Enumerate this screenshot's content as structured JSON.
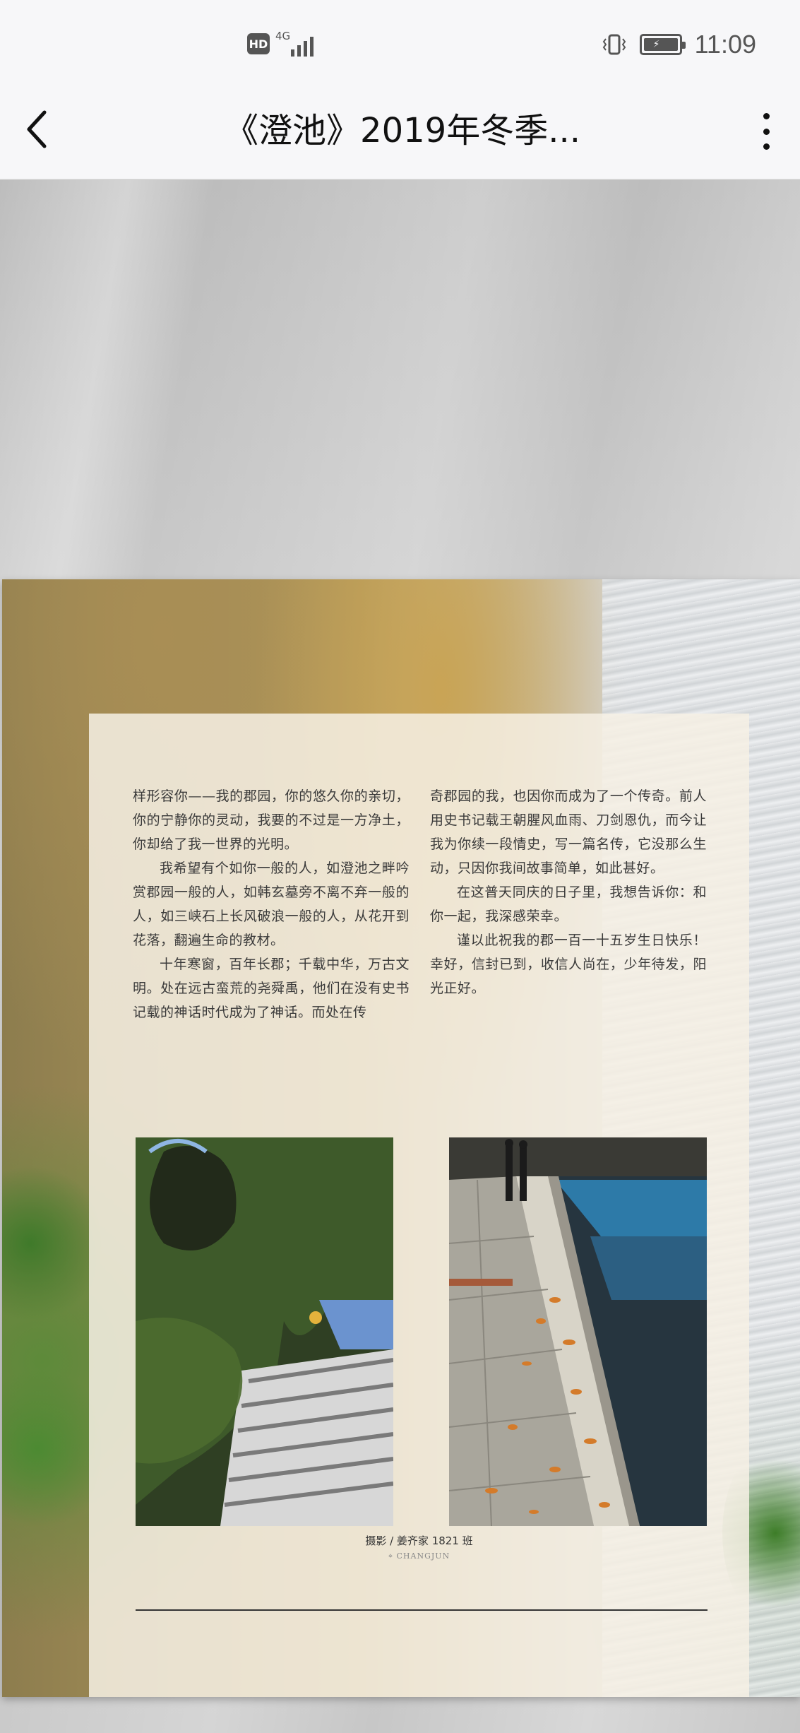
{
  "status_bar": {
    "hd": "HD",
    "network": "4G",
    "time": "11:09"
  },
  "header": {
    "title": "《澄池》2019年冬季..."
  },
  "icons": {
    "back": "back-arrow-icon",
    "more": "more-vertical-icon",
    "signal": "signal-icon",
    "vibrate": "vibrate-icon",
    "battery": "battery-charging-icon",
    "location": "location-pin-icon"
  },
  "article": {
    "left_column": [
      "样形容你——我的郡园，你的悠久你的亲切，你的宁静你的灵动，我要的不过是一方净土，你却给了我一世界的光明。",
      "我希望有个如你一般的人，如澄池之畔吟赏郡园一般的人，如韩玄墓旁不离不弃一般的人，如三峡石上长风破浪一般的人，从花开到花落，翻遍生命的教材。",
      "十年寒窗，百年长郡；千载中华，万古文明。处在远古蛮荒的尧舜禹，他们在没有史书记载的神话时代成为了神话。而处在传"
    ],
    "right_column": [
      "奇郡园的我，也因你而成为了一个传奇。前人用史书记载王朝腥风血雨、刀剑恩仇，而今让我为你续一段情史，写一篇名传，它没那么生动，只因你我间故事简单，如此甚好。",
      "在这普天同庆的日子里，我想告诉你：和你一起，我深感荣幸。",
      "谨以此祝我的郡一百一十五岁生日快乐！幸好，信封已到，收信人尚在，少年待发，阳光正好。"
    ]
  },
  "photos": {
    "left": "tree-building-photo",
    "right": "sidewalk-autumn-leaves-photo"
  },
  "caption": {
    "credit": "摄影 / 姜齐家 1821 班",
    "location": "CHANGJUN"
  },
  "colors": {
    "toolbar_bg": "#f7f7f9",
    "panel_bg": "#f6f0e4",
    "text": "#3a3a3a"
  }
}
